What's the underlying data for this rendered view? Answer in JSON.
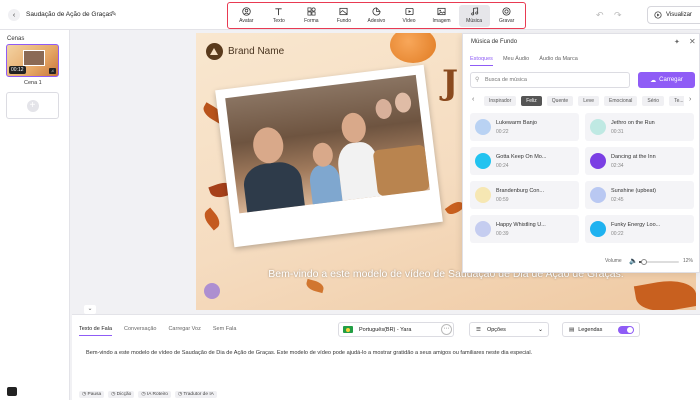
{
  "header": {
    "back_icon": "arrow-left-icon",
    "title": "Saudação de Ação de Graças",
    "edit_icon": "pencil-icon",
    "tools": [
      {
        "label": "Avatar",
        "icon": "avatar-icon",
        "active": false
      },
      {
        "label": "Texto",
        "icon": "text-icon",
        "active": false
      },
      {
        "label": "Forma",
        "icon": "shapes-icon",
        "active": false
      },
      {
        "label": "Fundo",
        "icon": "background-icon",
        "active": false
      },
      {
        "label": "Adesivo",
        "icon": "sticker-icon",
        "active": false
      },
      {
        "label": "Vídeo",
        "icon": "video-icon",
        "active": false
      },
      {
        "label": "Imagem",
        "icon": "image-icon",
        "active": false
      },
      {
        "label": "Música",
        "icon": "music-icon",
        "active": true
      },
      {
        "label": "Gravar",
        "icon": "record-icon",
        "active": false
      }
    ],
    "preview_label": "Visualizar"
  },
  "scenes": {
    "label": "Cenas",
    "items": [
      {
        "name": "Cena 1",
        "duration": "00:12"
      }
    ]
  },
  "canvas": {
    "brand_name": "Brand Name",
    "big_letter": "J",
    "caption": "Bem-vindo a este modelo de vídeo de Saudação de Dia de Ação de Graças."
  },
  "music_panel": {
    "title": "Música de Fundo",
    "tabs": [
      {
        "label": "Estoques",
        "active": true
      },
      {
        "label": "Meu Áudio",
        "active": false
      },
      {
        "label": "Áudio da Marca",
        "active": false
      }
    ],
    "search_placeholder": "Busca de música",
    "upload_label": "Carregar",
    "chips": [
      {
        "label": "Inspirador",
        "active": false
      },
      {
        "label": "Feliz",
        "active": true
      },
      {
        "label": "Quente",
        "active": false
      },
      {
        "label": "Leve",
        "active": false
      },
      {
        "label": "Emocional",
        "active": false
      },
      {
        "label": "Sério",
        "active": false
      },
      {
        "label": "Te...",
        "active": false
      }
    ],
    "tracks": [
      {
        "name": "Lukewarm Banjo",
        "time": "00:22",
        "color": "#b9d2f3"
      },
      {
        "name": "Jethro on the Run",
        "time": "00:31",
        "color": "#bfe9e3"
      },
      {
        "name": "Gotta Keep On Mo...",
        "time": "00:24",
        "color": "#22c3f0"
      },
      {
        "name": "Dancing at the Inn",
        "time": "02:34",
        "color": "#7b3fe4"
      },
      {
        "name": "Brandenburg Con...",
        "time": "00:59",
        "color": "#f6e7b3"
      },
      {
        "name": "Sunshine (upbeat)",
        "time": "02:45",
        "color": "#b9c8f2"
      },
      {
        "name": "Happy Whistling U...",
        "time": "00:39",
        "color": "#c5cdf0"
      },
      {
        "name": "Funky Energy Loo...",
        "time": "00:22",
        "color": "#1fb2f0"
      }
    ],
    "volume_label": "Volume",
    "volume_value": "12%",
    "volume_level": 0.12
  },
  "editor": {
    "tabs": [
      {
        "label": "Texto de Fala",
        "active": true
      },
      {
        "label": "Conversação",
        "active": false
      },
      {
        "label": "Carregar Voz",
        "active": false
      },
      {
        "label": "Sem Fala",
        "active": false
      }
    ],
    "language": "Português(BR) - Yara",
    "options_label": "Opções",
    "subtitles_label": "Legendas",
    "script": "Bem-vindo a este modelo de vídeo de Saudação de Dia de Ação de Graças. Este modelo de vídeo pode ajudá-lo a mostrar gratidão a seus amigos ou familiares neste dia especial.",
    "actions": [
      "Pausa",
      "Dicção",
      "IA Roteiro",
      "Tradutor de IA"
    ]
  },
  "colors": {
    "accent": "#8f5cf6",
    "highlight_border": "#e83a52"
  }
}
